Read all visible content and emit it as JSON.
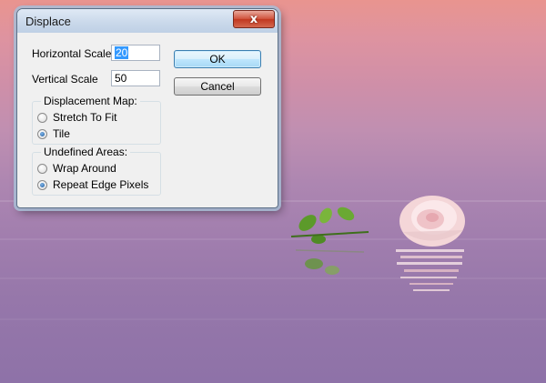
{
  "dialog": {
    "title": "Displace",
    "close_glyph": "x",
    "horizontal_scale": {
      "label": "Horizontal Scale",
      "value": "20"
    },
    "vertical_scale": {
      "label": "Vertical Scale",
      "value": "50"
    },
    "ok_label": "OK",
    "cancel_label": "Cancel",
    "displacement_map": {
      "title": "Displacement Map:",
      "options": [
        {
          "label": "Stretch To Fit",
          "checked": false
        },
        {
          "label": "Tile",
          "checked": true
        }
      ]
    },
    "undefined_areas": {
      "title": "Undefined Areas:",
      "options": [
        {
          "label": "Wrap Around",
          "checked": false
        },
        {
          "label": "Repeat Edge Pixels",
          "checked": true
        }
      ]
    }
  },
  "colors": {
    "accent_blue": "#3399ff",
    "close_red": "#c13820",
    "sky_top": "#e9948f",
    "sky_bottom": "#8e72a8"
  },
  "icons": {
    "close": "close-icon",
    "radio_selected": "radio-checked-icon",
    "radio_unselected": "radio-unchecked-icon"
  }
}
